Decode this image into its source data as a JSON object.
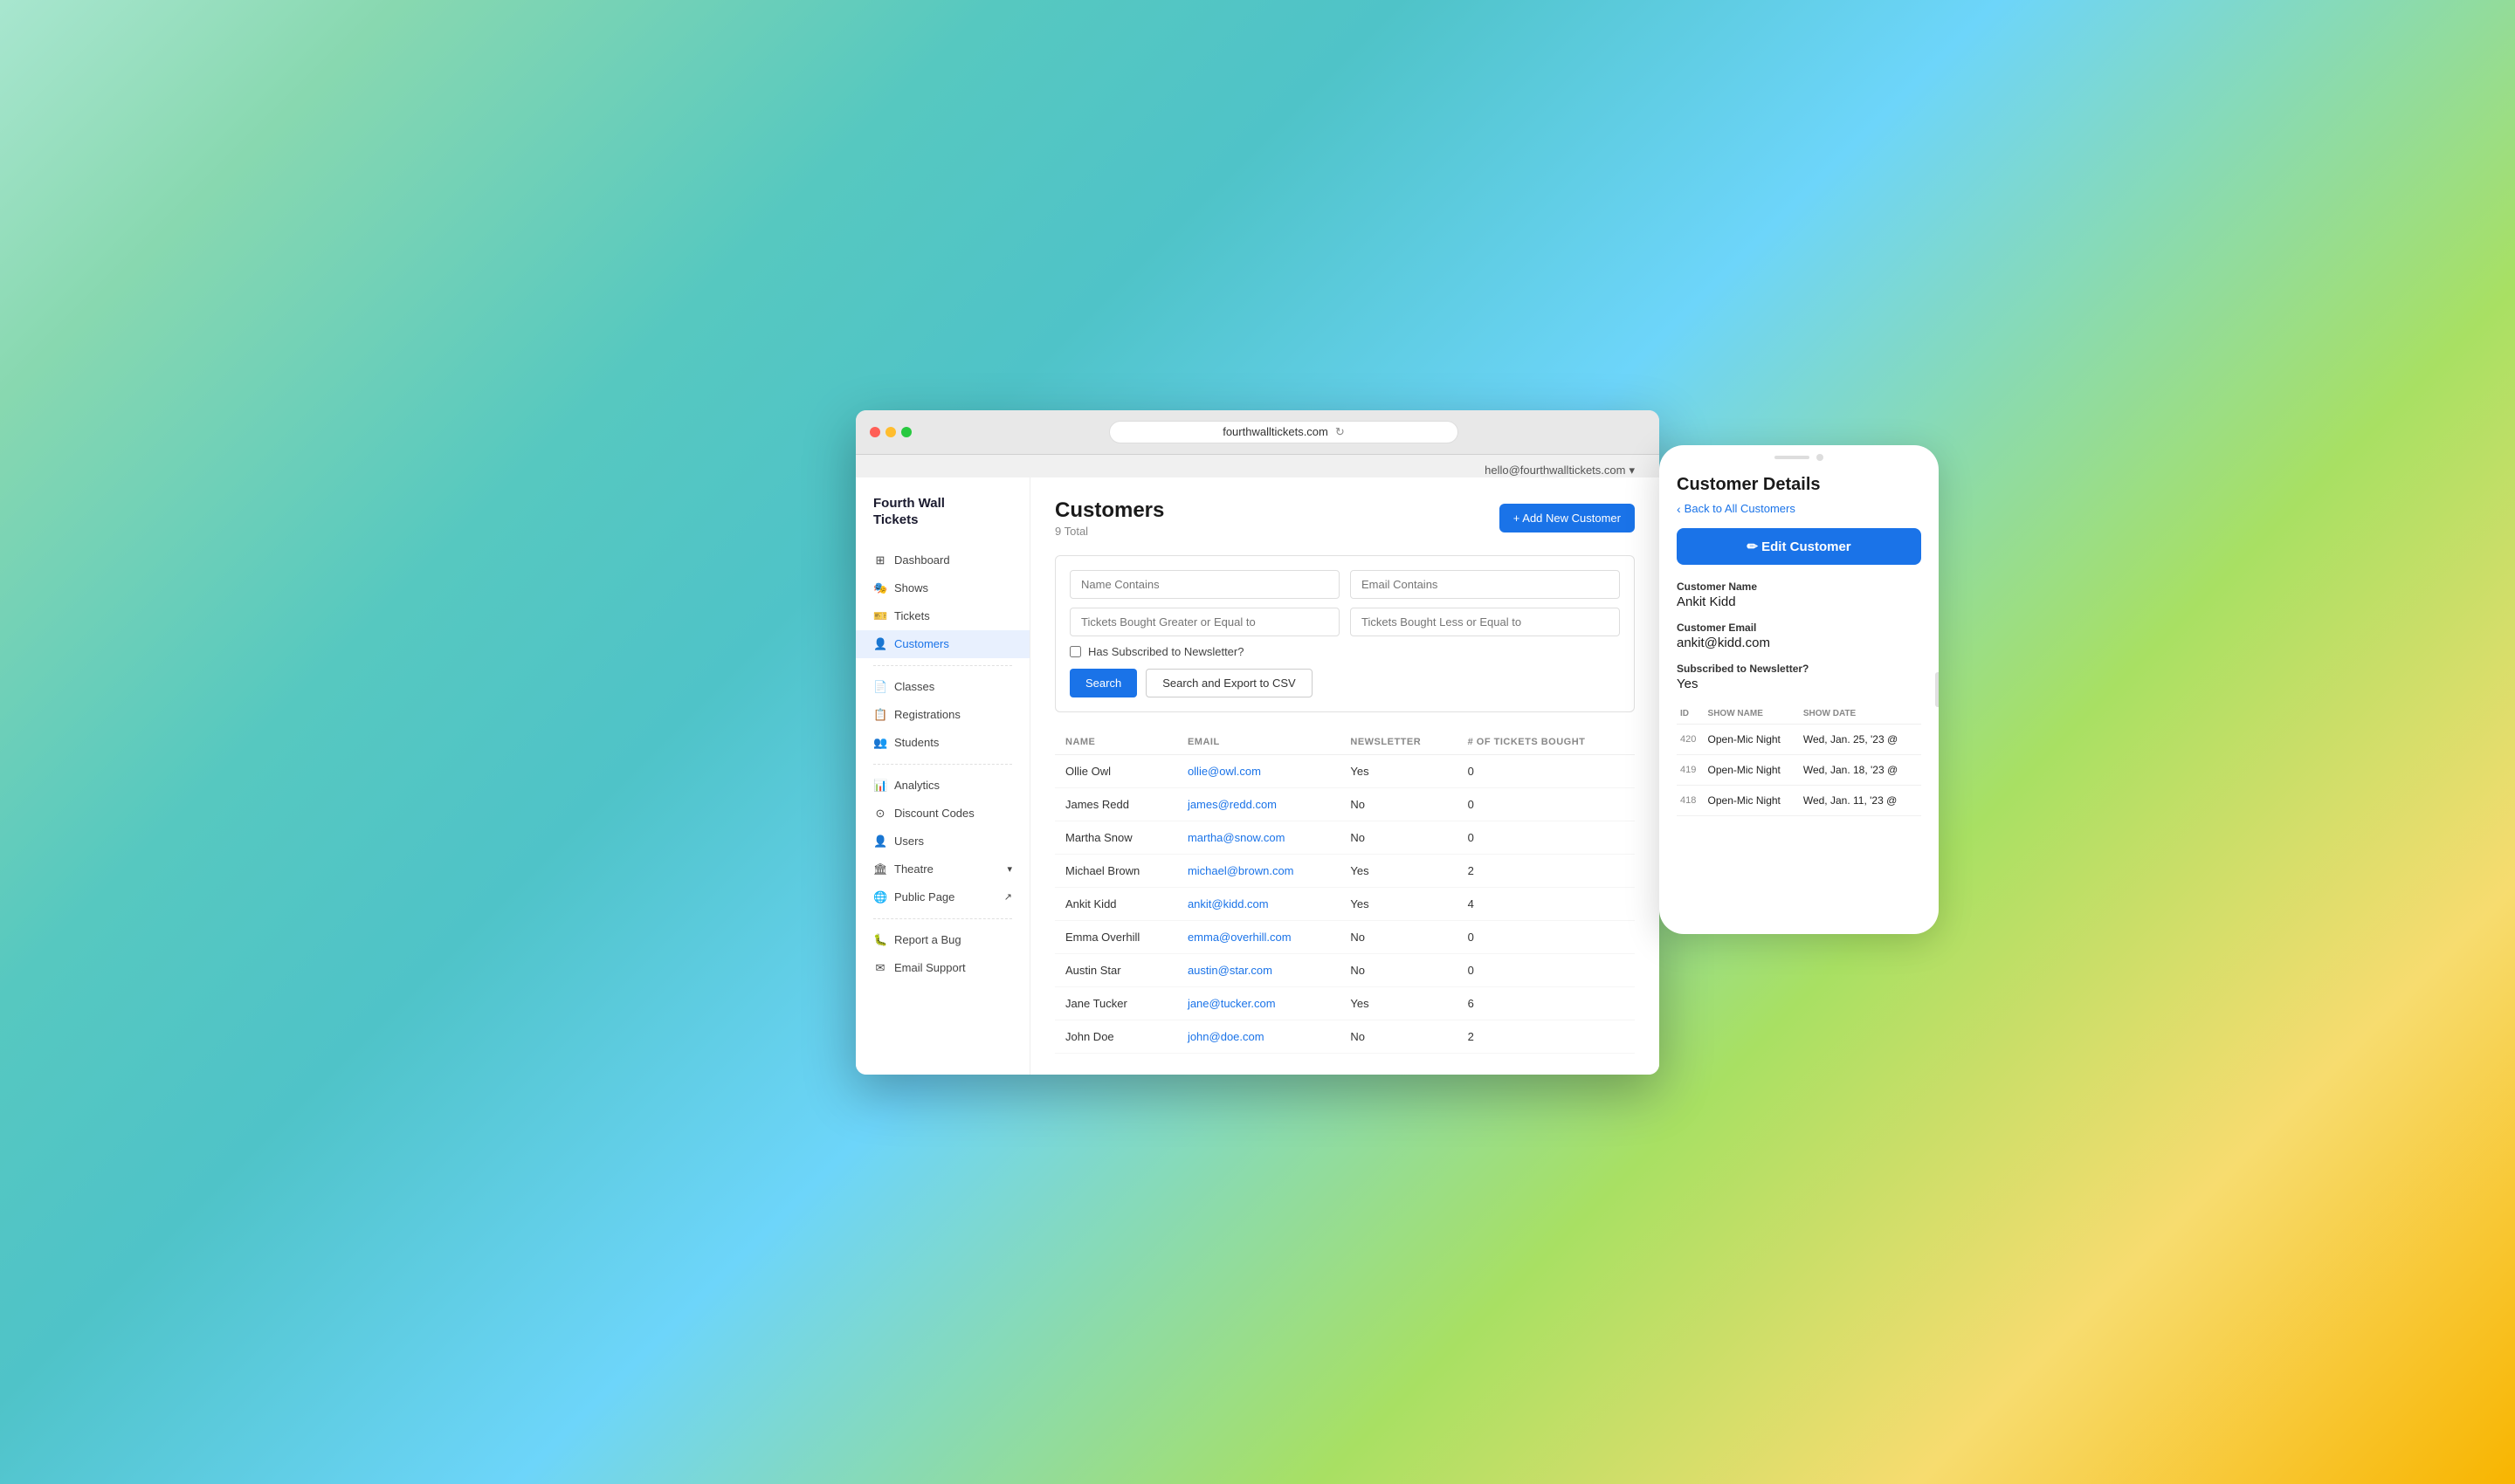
{
  "browser": {
    "url": "fourthwalltickets.com",
    "reload_icon": "↻"
  },
  "topbar": {
    "user_email": "hello@fourthwalltickets.com",
    "dropdown_icon": "▾"
  },
  "sidebar": {
    "logo": "Fourth Wall\nTickets",
    "nav_items": [
      {
        "id": "dashboard",
        "label": "Dashboard",
        "icon": "⊞",
        "active": false
      },
      {
        "id": "shows",
        "label": "Shows",
        "icon": "🎭",
        "active": false
      },
      {
        "id": "tickets",
        "label": "Tickets",
        "icon": "🎫",
        "active": false
      },
      {
        "id": "customers",
        "label": "Customers",
        "icon": "👤",
        "active": true
      }
    ],
    "nav_items2": [
      {
        "id": "classes",
        "label": "Classes",
        "icon": "📄",
        "active": false
      },
      {
        "id": "registrations",
        "label": "Registrations",
        "icon": "📋",
        "active": false
      },
      {
        "id": "students",
        "label": "Students",
        "icon": "👥",
        "active": false
      }
    ],
    "nav_items3": [
      {
        "id": "analytics",
        "label": "Analytics",
        "icon": "📊",
        "active": false
      },
      {
        "id": "discount-codes",
        "label": "Discount Codes",
        "icon": "⊙",
        "active": false
      },
      {
        "id": "users",
        "label": "Users",
        "icon": "👤",
        "active": false
      },
      {
        "id": "theatre",
        "label": "Theatre",
        "icon": "🏛",
        "active": false,
        "expandable": true
      },
      {
        "id": "public-page",
        "label": "Public Page",
        "icon": "🌐",
        "active": false,
        "external": true
      }
    ],
    "nav_bottom": [
      {
        "id": "report-bug",
        "label": "Report a Bug",
        "icon": "🐛"
      },
      {
        "id": "email-support",
        "label": "Email Support",
        "icon": "✉"
      }
    ]
  },
  "customers_page": {
    "title": "Customers",
    "total": "9 Total",
    "add_button": "+ Add New Customer",
    "filters": {
      "name_contains_placeholder": "Name Contains",
      "email_contains_placeholder": "Email Contains",
      "tickets_gte_placeholder": "Tickets Bought Greater or Equal to",
      "tickets_lte_placeholder": "Tickets Bought Less or Equal to",
      "newsletter_label": "Has Subscribed to Newsletter?",
      "search_btn": "Search",
      "export_btn": "Search and Export to CSV"
    },
    "table": {
      "columns": [
        "NAME",
        "EMAIL",
        "NEWSLETTER",
        "# OF TICKETS BOUGHT"
      ],
      "rows": [
        {
          "name": "Ollie Owl",
          "email": "ollie@owl.com",
          "newsletter": "Yes",
          "tickets": "0"
        },
        {
          "name": "James Redd",
          "email": "james@redd.com",
          "newsletter": "No",
          "tickets": "0"
        },
        {
          "name": "Martha Snow",
          "email": "martha@snow.com",
          "newsletter": "No",
          "tickets": "0"
        },
        {
          "name": "Michael Brown",
          "email": "michael@brown.com",
          "newsletter": "Yes",
          "tickets": "2"
        },
        {
          "name": "Ankit Kidd",
          "email": "ankit@kidd.com",
          "newsletter": "Yes",
          "tickets": "4"
        },
        {
          "name": "Emma Overhill",
          "email": "emma@overhill.com",
          "newsletter": "No",
          "tickets": "0"
        },
        {
          "name": "Austin Star",
          "email": "austin@star.com",
          "newsletter": "No",
          "tickets": "0"
        },
        {
          "name": "Jane Tucker",
          "email": "jane@tucker.com",
          "newsletter": "Yes",
          "tickets": "6"
        },
        {
          "name": "John Doe",
          "email": "john@doe.com",
          "newsletter": "No",
          "tickets": "2"
        }
      ]
    }
  },
  "customer_detail": {
    "title": "Customer Details",
    "back_label": "Back to All Customers",
    "edit_button": "✏ Edit Customer",
    "customer_name_label": "Customer Name",
    "customer_name": "Ankit Kidd",
    "customer_email_label": "Customer Email",
    "customer_email": "ankit@kidd.com",
    "newsletter_label": "Subscribed to Newsletter?",
    "newsletter_value": "Yes",
    "tickets_columns": [
      "ID",
      "SHOW NAME",
      "SHOW DATE"
    ],
    "tickets": [
      {
        "id": "420",
        "show_name": "Open-Mic Night",
        "show_date": "Wed, Jan. 25, '23 @"
      },
      {
        "id": "419",
        "show_name": "Open-Mic Night",
        "show_date": "Wed, Jan. 18, '23 @"
      },
      {
        "id": "418",
        "show_name": "Open-Mic Night",
        "show_date": "Wed, Jan. 11, '23 @"
      }
    ]
  },
  "colors": {
    "primary_blue": "#1a73e8",
    "active_bg": "#e8f0fe",
    "active_text": "#1a73e8"
  }
}
